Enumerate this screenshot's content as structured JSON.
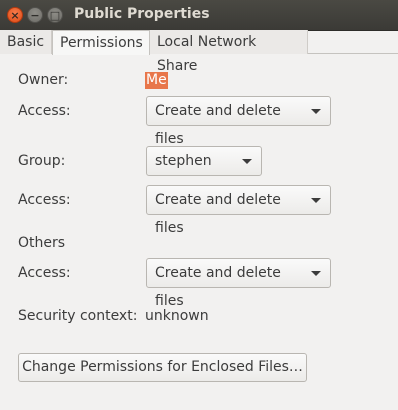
{
  "window": {
    "title": "Public Properties",
    "controls": {
      "close": "×",
      "minimize": "−",
      "maximize": "□"
    }
  },
  "tabs": [
    {
      "label": "Basic"
    },
    {
      "label": "Permissions",
      "active": true
    },
    {
      "label": "Local Network Share"
    }
  ],
  "owner": {
    "label": "Owner:",
    "value": "Me"
  },
  "owner_access": {
    "label": "Access:",
    "value": "Create and delete files"
  },
  "group": {
    "label": "Group:",
    "value": "stephen"
  },
  "group_access": {
    "label": "Access:",
    "value": "Create and delete files"
  },
  "others": {
    "label": "Others"
  },
  "others_access": {
    "label": "Access:",
    "value": "Create and delete files"
  },
  "security": {
    "label": "Security context:",
    "value": "unknown"
  },
  "enclosed_button": {
    "label": "Change Permissions for Enclosed Files…"
  },
  "colors": {
    "accent": "#e8764a",
    "titlebar": "#3c3b37",
    "background": "#f2f1f0"
  }
}
